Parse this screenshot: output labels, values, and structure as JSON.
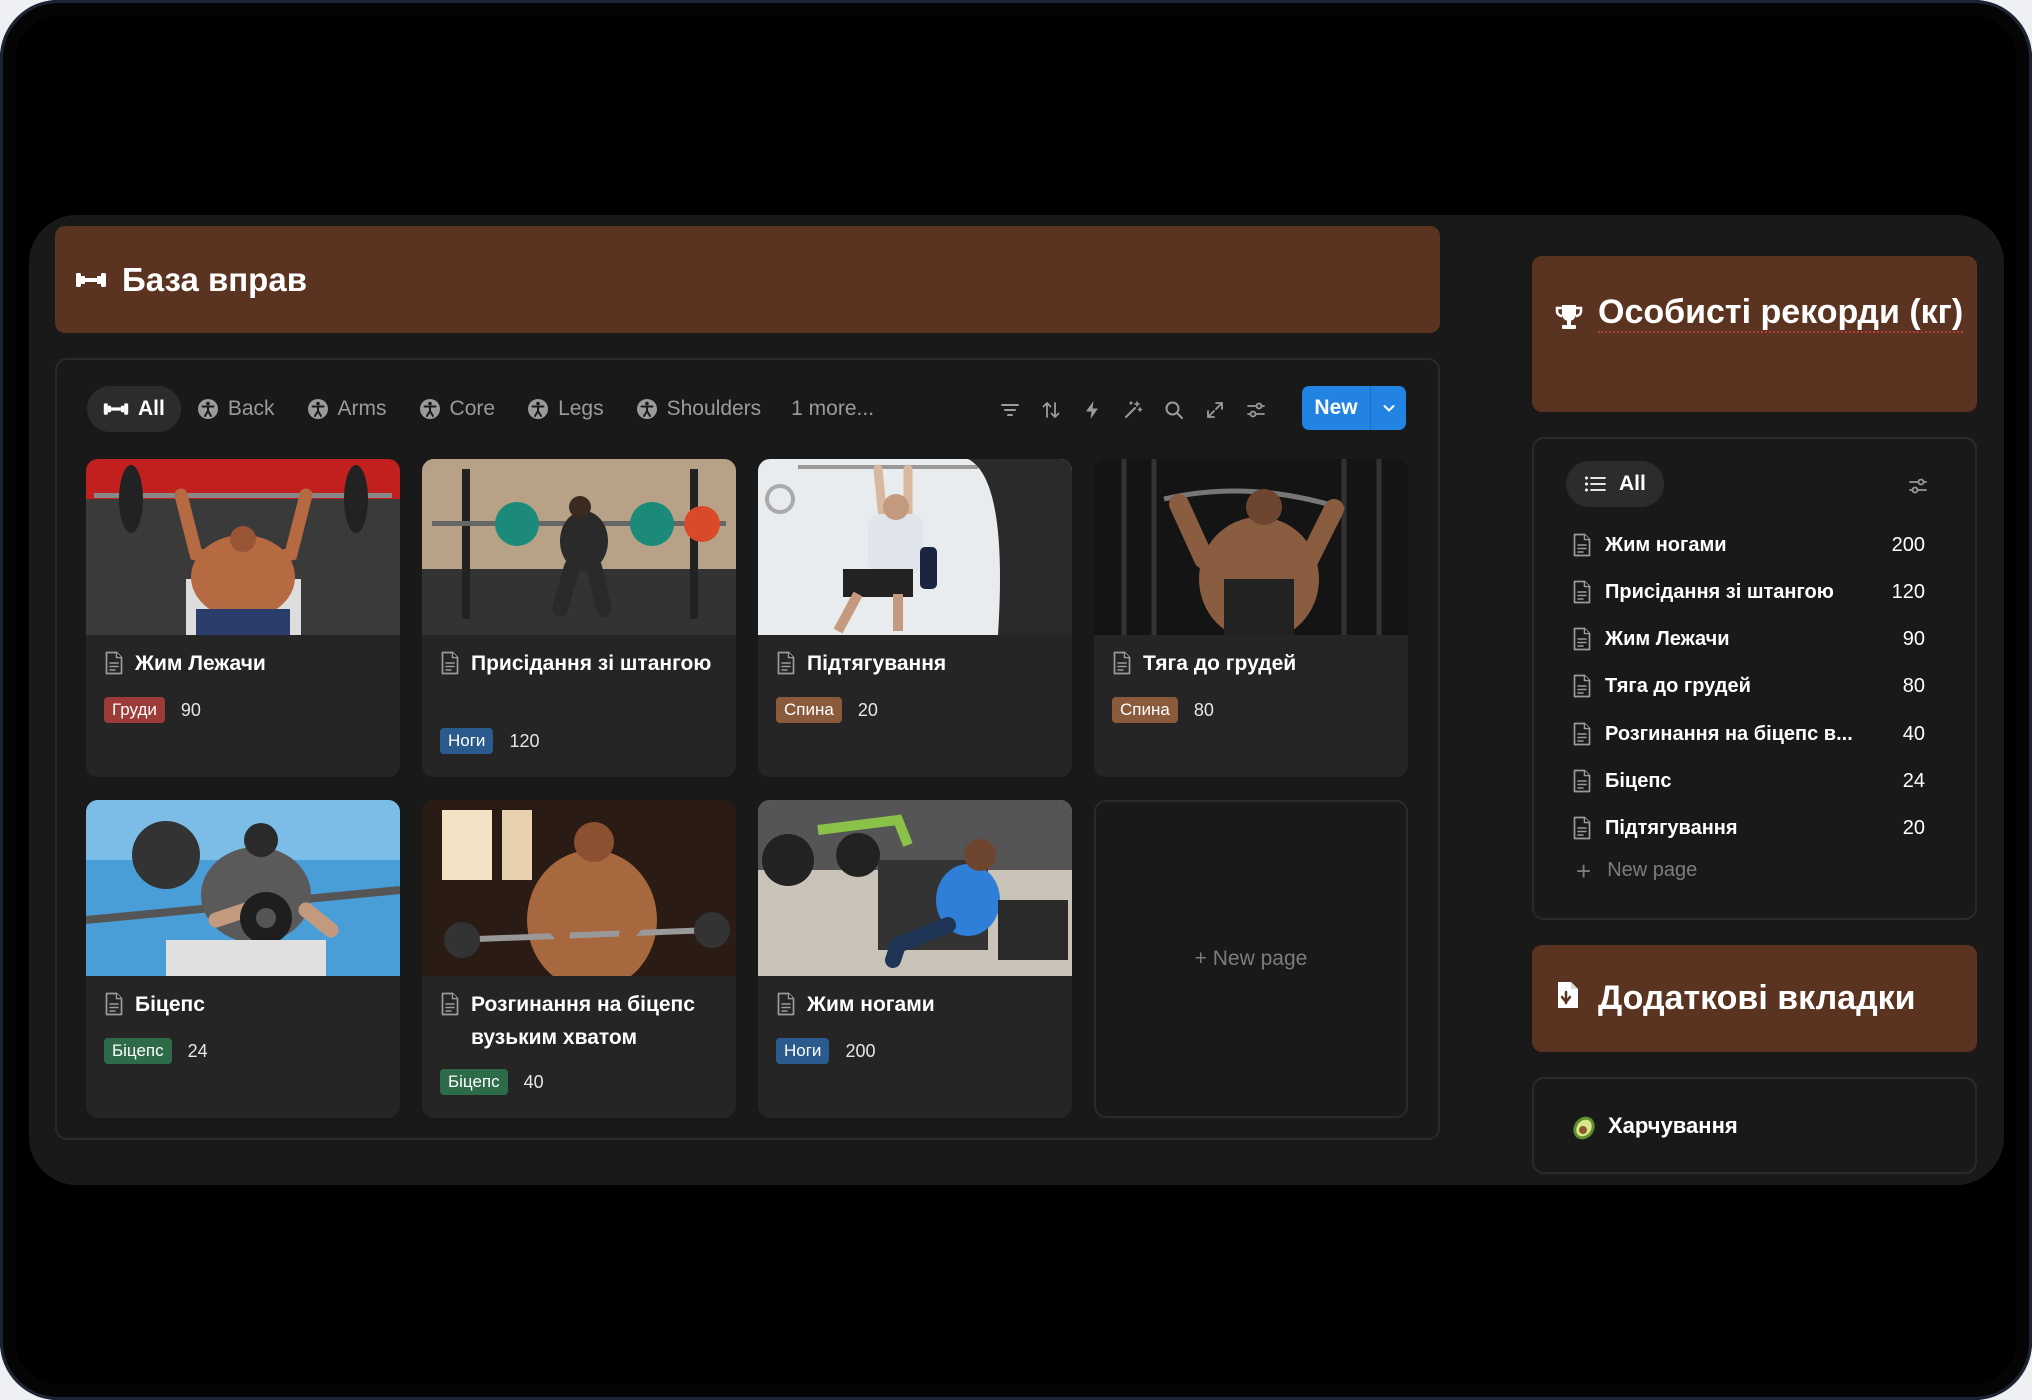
{
  "colors": {
    "accent": "#2383e2",
    "banner_bg": "#5a3420",
    "panel_bg": "#191919",
    "card_bg": "#252525"
  },
  "main_section": {
    "title": "База вправ",
    "icon": "dumbbell-icon",
    "tabs": [
      {
        "label": "All",
        "icon": "dumbbell-icon",
        "active": true
      },
      {
        "label": "Back",
        "icon": "accessibility-icon"
      },
      {
        "label": "Arms",
        "icon": "accessibility-icon"
      },
      {
        "label": "Core",
        "icon": "accessibility-icon"
      },
      {
        "label": "Legs",
        "icon": "accessibility-icon"
      },
      {
        "label": "Shoulders",
        "icon": "accessibility-icon"
      },
      {
        "label": "1 more..."
      }
    ],
    "toolbar_icons": [
      "filter-icon",
      "sort-icon",
      "lightning-icon",
      "ai-sparkle-icon",
      "search-icon",
      "expand-icon",
      "settings-icon"
    ],
    "new_button": {
      "label": "New",
      "dropdown_icon": "chevron-down-icon"
    },
    "cards": [
      {
        "title": "Жим Лежачи",
        "tag": "Груди",
        "tag_color": "#9c3b38",
        "value": "90"
      },
      {
        "title": "Присідання зі штангою",
        "tag": "Ноги",
        "tag_color": "#2b5b8c",
        "value": "120"
      },
      {
        "title": "Підтягування",
        "tag": "Спина",
        "tag_color": "#8a5a3c",
        "value": "20"
      },
      {
        "title": "Тяга до грудей",
        "tag": "Спина",
        "tag_color": "#8a5a3c",
        "value": "80"
      },
      {
        "title": "Біцепс",
        "tag": "Біцепс",
        "tag_color": "#2e6b48",
        "value": "24"
      },
      {
        "title": "Розгинання на біцепс вузьким хватом",
        "tag": "Біцепс",
        "tag_color": "#2e6b48",
        "value": "40"
      },
      {
        "title": "Жим ногами",
        "tag": "Ноги",
        "tag_color": "#2b5b8c",
        "value": "200"
      }
    ],
    "new_page_label": "+ New page"
  },
  "records_section": {
    "title": "Особисті рекорди (кг)",
    "icon": "trophy-icon",
    "tab": {
      "label": "All",
      "icon": "list-icon"
    },
    "settings_icon": "settings-icon",
    "rows": [
      {
        "name": "Жим ногами",
        "value": "200"
      },
      {
        "name": "Присідання зі штангою",
        "value": "120"
      },
      {
        "name": "Жим Лежачи",
        "value": "90"
      },
      {
        "name": "Тяга до грудей",
        "value": "80"
      },
      {
        "name": "Розгинання на біцепс в...",
        "value": "40"
      },
      {
        "name": "Біцепс",
        "value": "24"
      },
      {
        "name": "Підтягування",
        "value": "20"
      }
    ],
    "new_page_label": "New page"
  },
  "extra_section": {
    "title": "Додаткові вкладки",
    "icon": "document-icon",
    "items": [
      {
        "label": "Харчування",
        "icon": "avocado-icon"
      }
    ]
  }
}
